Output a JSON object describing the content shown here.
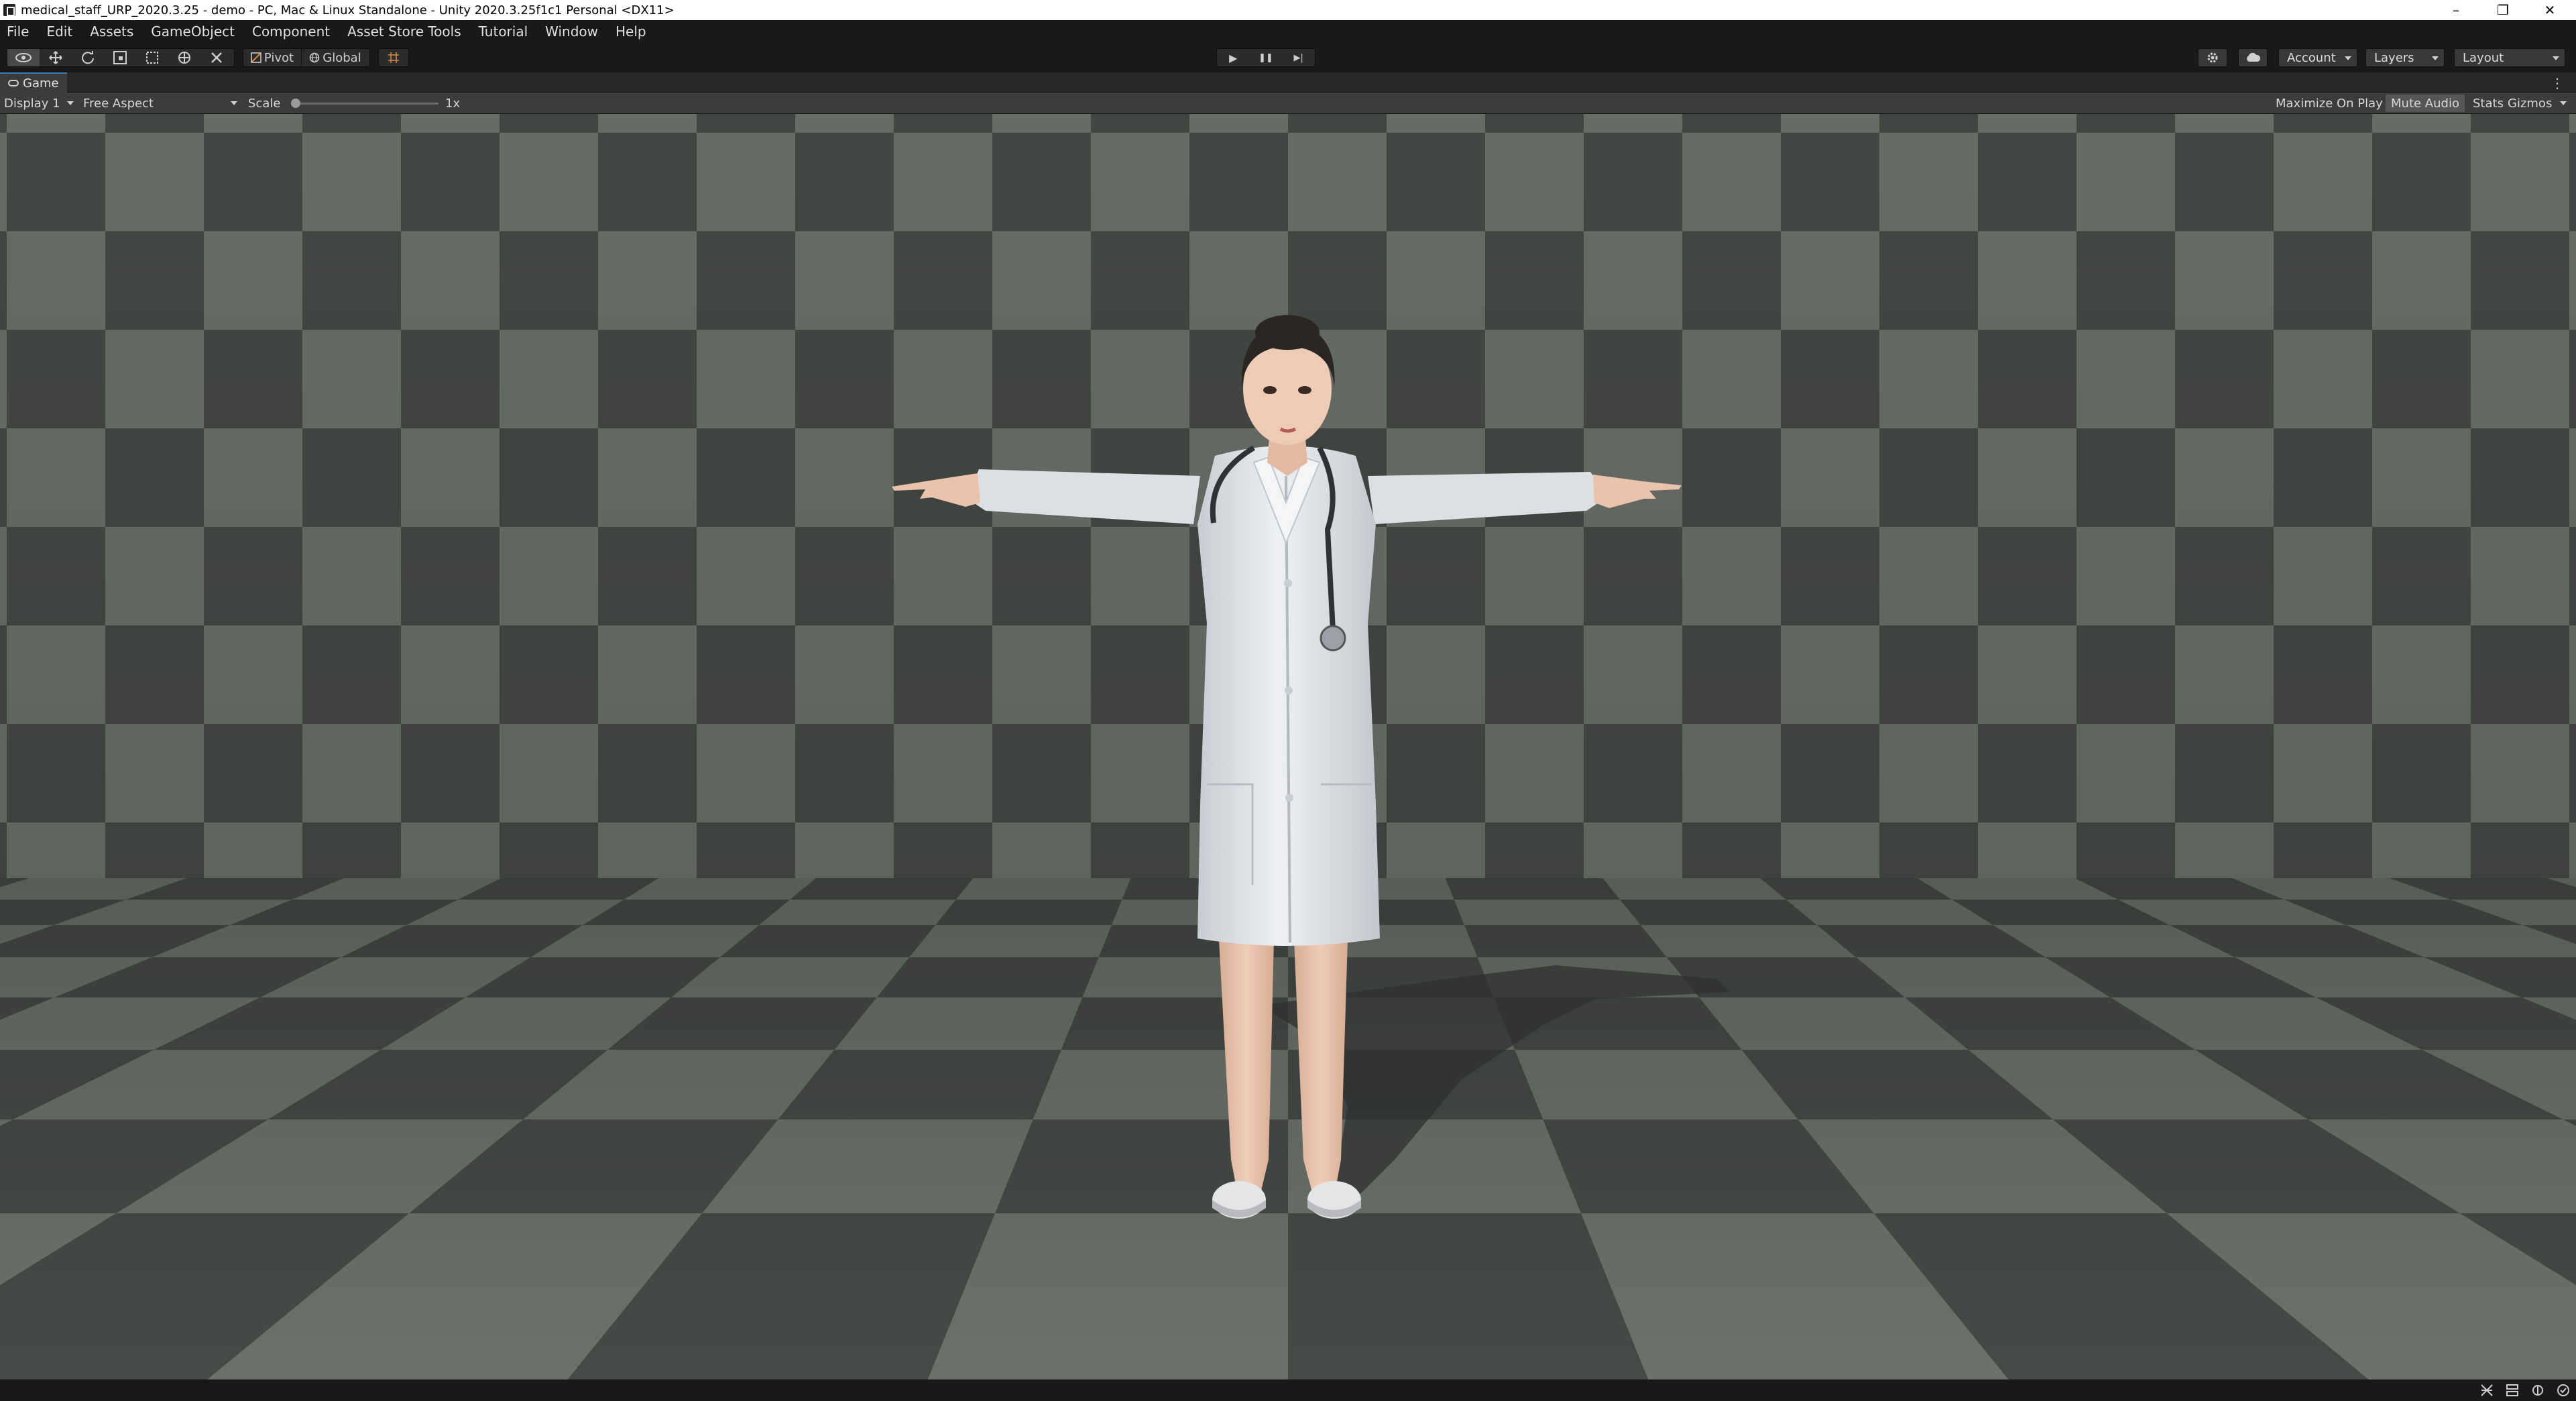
{
  "window": {
    "title": "medical_staff_URP_2020.3.25 - demo - PC, Mac & Linux Standalone - Unity 2020.3.25f1c1 Personal <DX11>",
    "minimize_glyph": "–",
    "maximize_glyph": "❐",
    "close_glyph": "✕"
  },
  "menu": [
    "File",
    "Edit",
    "Assets",
    "GameObject",
    "Component",
    "Asset Store Tools",
    "Tutorial",
    "Window",
    "Help"
  ],
  "toolbar": {
    "pivot_label": "Pivot",
    "global_label": "Global",
    "play_glyph": "▶",
    "pause_glyph": "❚❚",
    "step_glyph": "▶|",
    "account_label": "Account",
    "layers_label": "Layers",
    "layout_label": "Layout"
  },
  "tab": {
    "label": "Game"
  },
  "gamebar": {
    "display": "Display 1",
    "aspect": "Free Aspect",
    "scale_label": "Scale",
    "scale_value": "1x",
    "scale_level": 0.0,
    "maximize_on_play": "Maximize On Play",
    "mute_audio": "Mute Audio",
    "stats": "Stats",
    "gizmos": "Gizmos"
  },
  "colors": {
    "background": "#191919",
    "panel": "#3c3c3c",
    "checker_light": "#6c716b",
    "checker_dark": "#464a46",
    "coat": "#e8eaee",
    "skin": "#eac3ad"
  },
  "icons": {
    "view_tool": "eye-icon",
    "move_tool": "move-icon",
    "rotate_tool": "rotate-icon",
    "scale_tool": "scale-icon",
    "rect_tool": "rect-icon",
    "transform_tool": "transform-icon",
    "custom_tool": "custom-tool-icon",
    "snap": "grid-snap-icon",
    "services": "gear-icon",
    "collab": "cloud-icon"
  }
}
